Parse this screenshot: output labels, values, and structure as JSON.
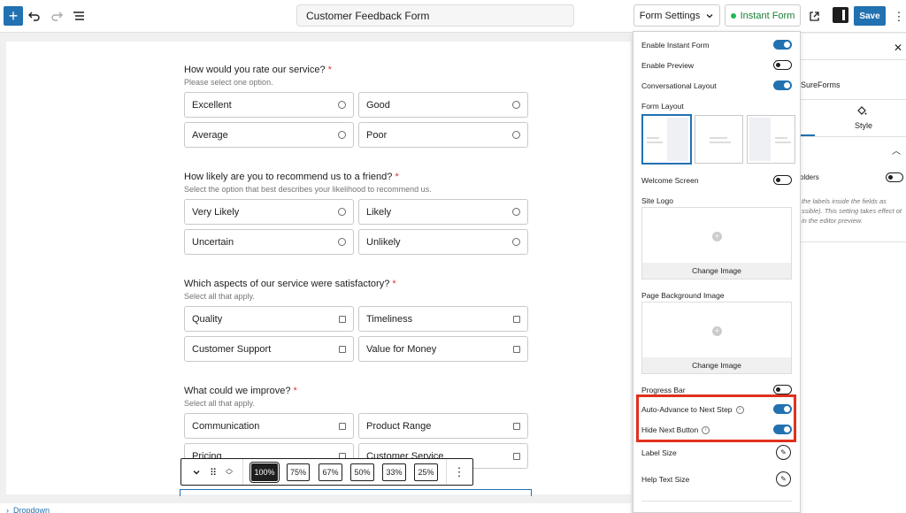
{
  "topbar": {
    "title": "Customer Feedback Form",
    "form_settings_label": "Form Settings",
    "instant_form_label": "Instant Form",
    "save_label": "Save"
  },
  "form": {
    "questions": [
      {
        "title": "How would you rate our service?",
        "required_mark": "*",
        "help": "Please select one option.",
        "type": "radio",
        "options": [
          "Excellent",
          "Good",
          "Average",
          "Poor"
        ]
      },
      {
        "title": "How likely are you to recommend us to a friend?",
        "required_mark": "*",
        "help": "Select the option that best describes your likelihood to recommend us.",
        "type": "radio",
        "options": [
          "Very Likely",
          "Likely",
          "Uncertain",
          "Unlikely"
        ]
      },
      {
        "title": "Which aspects of our service were satisfactory?",
        "required_mark": "*",
        "help": "Select all that apply.",
        "type": "checkbox",
        "options": [
          "Quality",
          "Timeliness",
          "Customer Support",
          "Value for Money"
        ]
      },
      {
        "title": "What could we improve?",
        "required_mark": "*",
        "help": "Select all that apply.",
        "type": "checkbox",
        "options": [
          "Communication",
          "Product Range",
          "Pricing",
          "Customer Service"
        ]
      }
    ]
  },
  "zoombar": {
    "levels": [
      "100%",
      "75%",
      "67%",
      "50%",
      "33%",
      "25%"
    ],
    "active": "100%"
  },
  "breadcrumb": {
    "label": "Dropdown"
  },
  "sidebar": {
    "brand": "SureForms",
    "style_tab": "Style",
    "holders_label": "olders",
    "description": "the labels inside the fields as ssible). This setting takes effect ot in the editor preview."
  },
  "settings_panel": {
    "enable_instant_form": {
      "label": "Enable Instant Form",
      "on": true
    },
    "enable_preview": {
      "label": "Enable Preview",
      "on": false
    },
    "conversational_layout": {
      "label": "Conversational Layout",
      "on": true
    },
    "form_layout_label": "Form Layout",
    "welcome_screen": {
      "label": "Welcome Screen",
      "on": false
    },
    "site_logo_label": "Site Logo",
    "change_image_label": "Change Image",
    "page_bg_label": "Page Background Image",
    "progress_bar": {
      "label": "Progress Bar",
      "on": false
    },
    "auto_advance": {
      "label": "Auto-Advance to Next Step",
      "on": true
    },
    "hide_next": {
      "label": "Hide Next Button",
      "on": true
    },
    "label_size": "Label Size",
    "help_text_size": "Help Text Size"
  },
  "colors": {
    "accent": "#2271b1",
    "highlight": "#e0301e",
    "instant_green": "#1db954"
  }
}
